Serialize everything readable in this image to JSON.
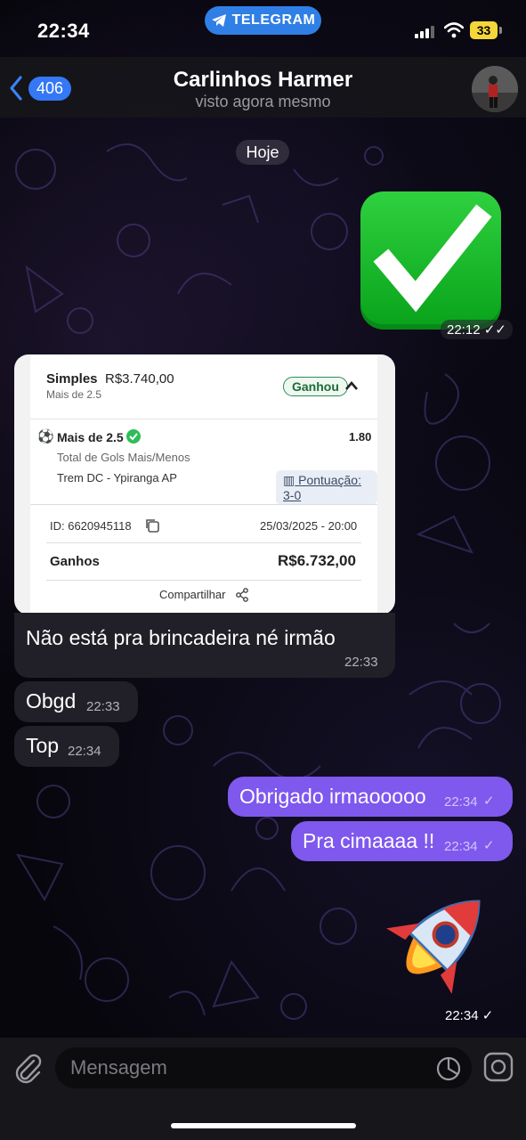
{
  "status_bar": {
    "time": "22:34",
    "pill_label": "TELEGRAM",
    "battery": "33"
  },
  "header": {
    "back_count": "406",
    "contact_name": "Carlinhos Harmer",
    "last_seen": "visto agora mesmo"
  },
  "date_chip": "Hoje",
  "messages": {
    "sticker_check": {
      "time": "22:12"
    },
    "bet_card": {
      "type_label": "Simples",
      "stake": "R$3.740,00",
      "sub_label": "Mais de 2.5",
      "status": "Ganhou",
      "selection": "Mais de 2.5",
      "odds": "1.80",
      "market": "Total de Gols Mais/Menos",
      "match": "Trem DC - Ypiranga AP",
      "score_label": "Pontuação: 3-0",
      "bet_id": "ID: 6620945118",
      "datetime": "25/03/2025 - 20:00",
      "winnings_label": "Ganhos",
      "winnings_value": "R$6.732,00",
      "share_label": "Compartilhar"
    },
    "in_1": {
      "text": "Não está pra brincadeira né irmão",
      "time": "22:33"
    },
    "in_2": {
      "text": "Obgd",
      "time": "22:33"
    },
    "in_3": {
      "text": "Top",
      "time": "22:34"
    },
    "out_1": {
      "text": "Obrigado irmaooooo",
      "time": "22:34"
    },
    "out_2": {
      "text": "Pra cimaaaa !!",
      "time": "22:34"
    },
    "sticker_rocket": {
      "time": "22:34"
    }
  },
  "composer": {
    "placeholder": "Mensagem"
  },
  "colors": {
    "outgoing": "#7f58ee",
    "incoming": "#212028",
    "telegram_blue": "#2f7fe6",
    "win_green": "#2e8b57"
  }
}
